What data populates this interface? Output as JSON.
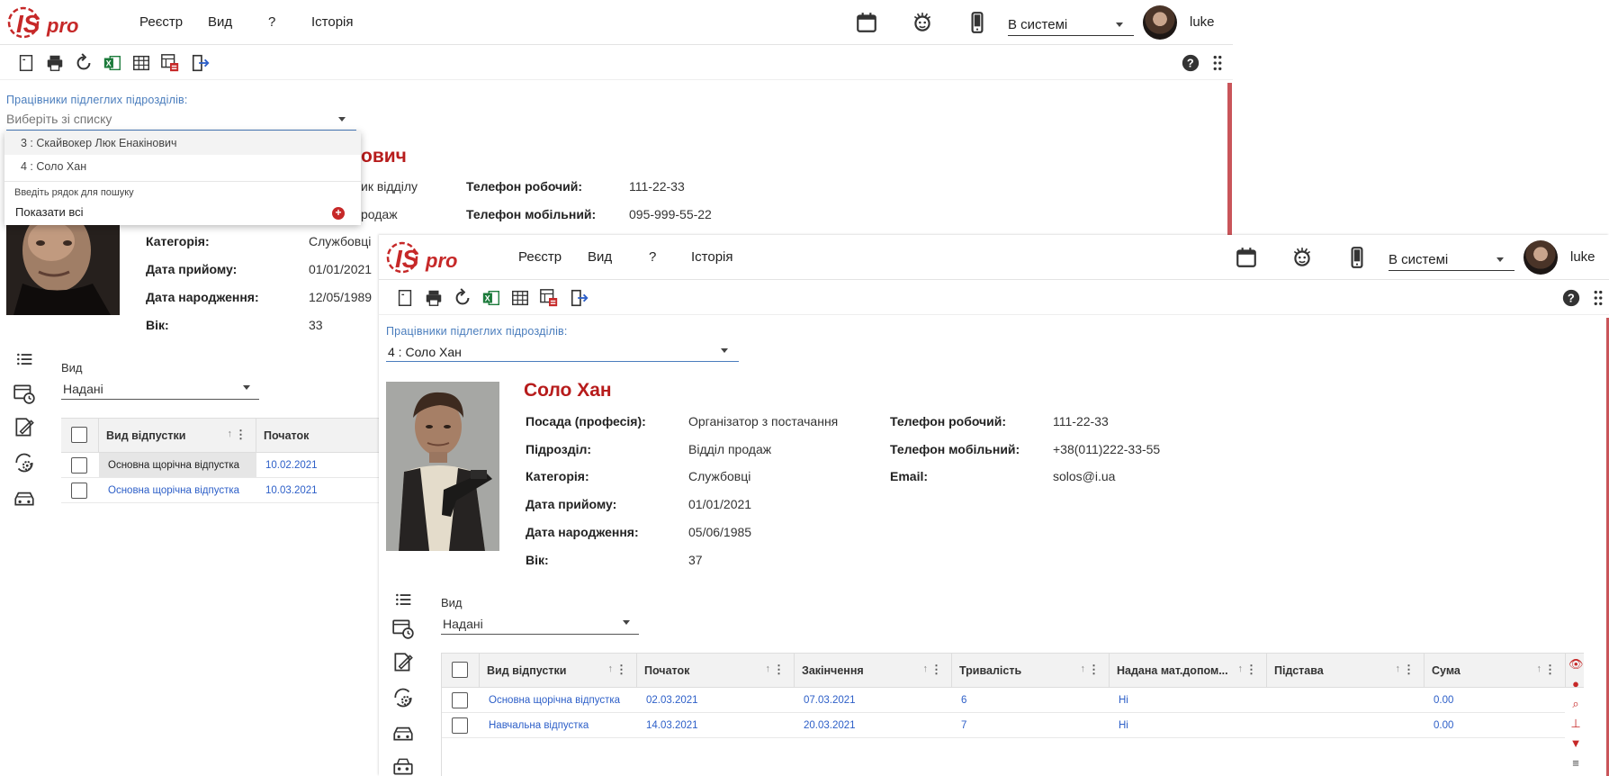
{
  "brand": {
    "logo_text": "ISpro",
    "accent": "#c62828",
    "link_color": "#2d5fc8",
    "label_color": "#4a7dbd"
  },
  "back_window": {
    "menu": [
      "Реєстр",
      "Вид",
      "?",
      "Історія"
    ],
    "status": "В системі",
    "user": "luke",
    "field_label": "Працівники підлеглих підрозділів:",
    "field_placeholder": "Виберіть зі списку",
    "dropdown": {
      "items": [
        "3 : Скайвокер Люк Енакінович",
        "4 : Соло Хан"
      ],
      "hint": "Введіть рядок для пошуку",
      "show_all": "Показати всі"
    },
    "name_fragment": "ович",
    "position_fragment": "ик відділу",
    "department_fragment": "родаж",
    "labels": {
      "category": "Категорія:",
      "hire_date": "Дата прийому:",
      "birth_date": "Дата народження:",
      "age": "Вік:",
      "phone_work": "Телефон робочий:",
      "phone_mobile": "Телефон мобільний:"
    },
    "values": {
      "category": "Службовці",
      "hire_date": "01/01/2021",
      "birth_date": "12/05/1989",
      "age": "33",
      "phone_work": "111-22-33",
      "phone_mobile": "095-999-55-22"
    },
    "vid_label": "Вид",
    "vid_value": "Надані",
    "grid": {
      "headers": [
        "Вид відпустки",
        "Початок"
      ],
      "rows": [
        [
          "Основна щорічна відпустка",
          "10.02.2021"
        ],
        [
          "Основна щорічна відпустка",
          "10.03.2021"
        ]
      ]
    }
  },
  "front_window": {
    "menu": [
      "Реєстр",
      "Вид",
      "?",
      "Історія"
    ],
    "status": "В системі",
    "user": "luke",
    "field_label": "Працівники підлеглих підрозділів:",
    "field_value": "4 : Соло Хан",
    "person_name": "Соло Хан",
    "labels": {
      "position": "Посада (професія):",
      "department": "Підрозділ:",
      "category": "Категорія:",
      "hire_date": "Дата прийому:",
      "birth_date": "Дата народження:",
      "age": "Вік:",
      "phone_work": "Телефон робочий:",
      "phone_mobile": "Телефон мобільний:",
      "email": "Email:"
    },
    "values": {
      "position": "Організатор з постачання",
      "department": "Відділ продаж",
      "category": "Службовці",
      "hire_date": "01/01/2021",
      "birth_date": "05/06/1985",
      "age": "37",
      "phone_work": "111-22-33",
      "phone_mobile": "+38(011)222-33-55",
      "email": "solos@i.ua"
    },
    "vid_label": "Вид",
    "vid_value": "Надані",
    "grid": {
      "headers": [
        "Вид відпустки",
        "Початок",
        "Закінчення",
        "Тривалість",
        "Надана мат.допом...",
        "Підстава",
        "Сума"
      ],
      "rows": [
        [
          "Основна щорічна відпустка",
          "02.03.2021",
          "07.03.2021",
          "6",
          "Ні",
          "",
          "0.00"
        ],
        [
          "Навчальна відпустка",
          "14.03.2021",
          "20.03.2021",
          "7",
          "Ні",
          "",
          "0.00"
        ]
      ]
    }
  }
}
